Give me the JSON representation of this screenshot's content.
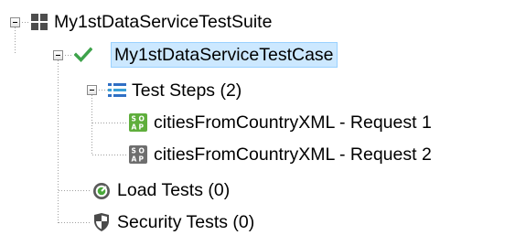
{
  "tree": {
    "suite": {
      "label": "My1stDataServiceTestSuite",
      "icon": "test-suite-grid-icon"
    },
    "test_case": {
      "label": "My1stDataServiceTestCase",
      "icon": "checkmark-icon",
      "selected": true
    },
    "test_steps": {
      "label": "Test Steps (2)",
      "icon": "test-steps-list-icon"
    },
    "requests": [
      {
        "label": "citiesFromCountryXML - Request 1",
        "icon": "soap-request-icon",
        "color": "#5fae3c"
      },
      {
        "label": "citiesFromCountryXML - Request 2",
        "icon": "soap-request-icon",
        "color": "#6e6e6e"
      }
    ],
    "load_tests": {
      "label": "Load Tests (0)",
      "icon": "load-tests-gauge-icon"
    },
    "security_tests": {
      "label": "Security Tests (0)",
      "icon": "security-shield-icon"
    }
  },
  "colors": {
    "selection_background": "#cce8ff",
    "selection_border": "#99d1ff",
    "check_green": "#3ea34b",
    "steps_blue": "#2f6fc4",
    "connector": "#a0a0a0"
  }
}
